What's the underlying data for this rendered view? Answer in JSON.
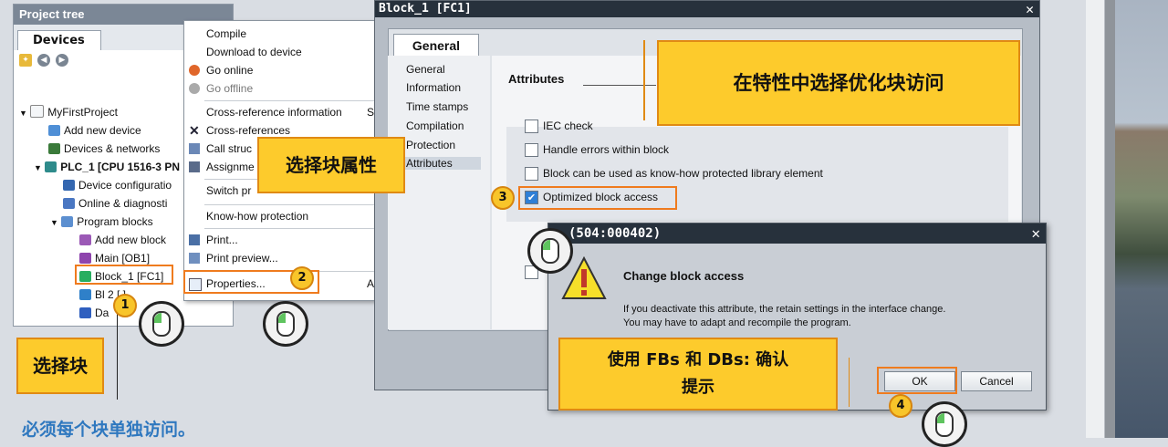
{
  "project_tree": {
    "title": "Project tree",
    "tab": "Devices",
    "items": [
      {
        "label": "MyFirstProject"
      },
      {
        "label": "Add new device"
      },
      {
        "label": "Devices & networks"
      },
      {
        "label": "PLC_1 [CPU 1516-3 PN"
      },
      {
        "label": "Device configuratio"
      },
      {
        "label": "Online & diagnosti"
      },
      {
        "label": "Program blocks"
      },
      {
        "label": "Add new block"
      },
      {
        "label": "Main [OB1]"
      },
      {
        "label": "Block_1 [FC1]"
      },
      {
        "label": "Bl   2 [  ]"
      },
      {
        "label": "Da"
      }
    ]
  },
  "context_menu": {
    "items": [
      {
        "label": "Compile"
      },
      {
        "label": "Download to device"
      },
      {
        "label": "Go online"
      },
      {
        "label": "Go offline"
      },
      {
        "label": "Cross-reference information"
      },
      {
        "label": "Cross-references"
      },
      {
        "label": "Call struc"
      },
      {
        "label": "Assignme"
      },
      {
        "label": "Switch pr"
      },
      {
        "label": "Know-how protection"
      },
      {
        "label": "Print..."
      },
      {
        "label": "Print preview..."
      },
      {
        "label": "Properties..."
      }
    ],
    "shortcut_s": "S",
    "shortcut_a": "A"
  },
  "block_dialog": {
    "title": "Block_1 [FC1]",
    "tab": "General",
    "nav": [
      "General",
      "Information",
      "Time stamps",
      "Compilation",
      "Protection",
      "Attributes"
    ],
    "section_heading": "Attributes",
    "checkboxes": [
      {
        "label": "IEC check",
        "checked": false
      },
      {
        "label": "Handle errors within block",
        "checked": false
      },
      {
        "label": "Block can be used as know-how protected library element",
        "checked": false
      },
      {
        "label": "Optimized block access",
        "checked": true
      }
    ]
  },
  "change_dialog": {
    "title": "(504:000402)",
    "heading": "Change block access",
    "line1": "If you deactivate this attribute, the retain settings in the interface change.",
    "line2": "You may have to adapt and recompile the program.",
    "ok": "OK",
    "cancel": "Cancel"
  },
  "annotations": {
    "select_props": "选择块属性",
    "select_block": "选择块",
    "optimize": "在特性中选择优化块访问",
    "confirm_line1": "使用 FBs 和 DBs: 确认",
    "confirm_line2": "提示",
    "footer_note": "必须每个块单独访问。",
    "steps": [
      "1",
      "2",
      "3",
      "4"
    ]
  }
}
